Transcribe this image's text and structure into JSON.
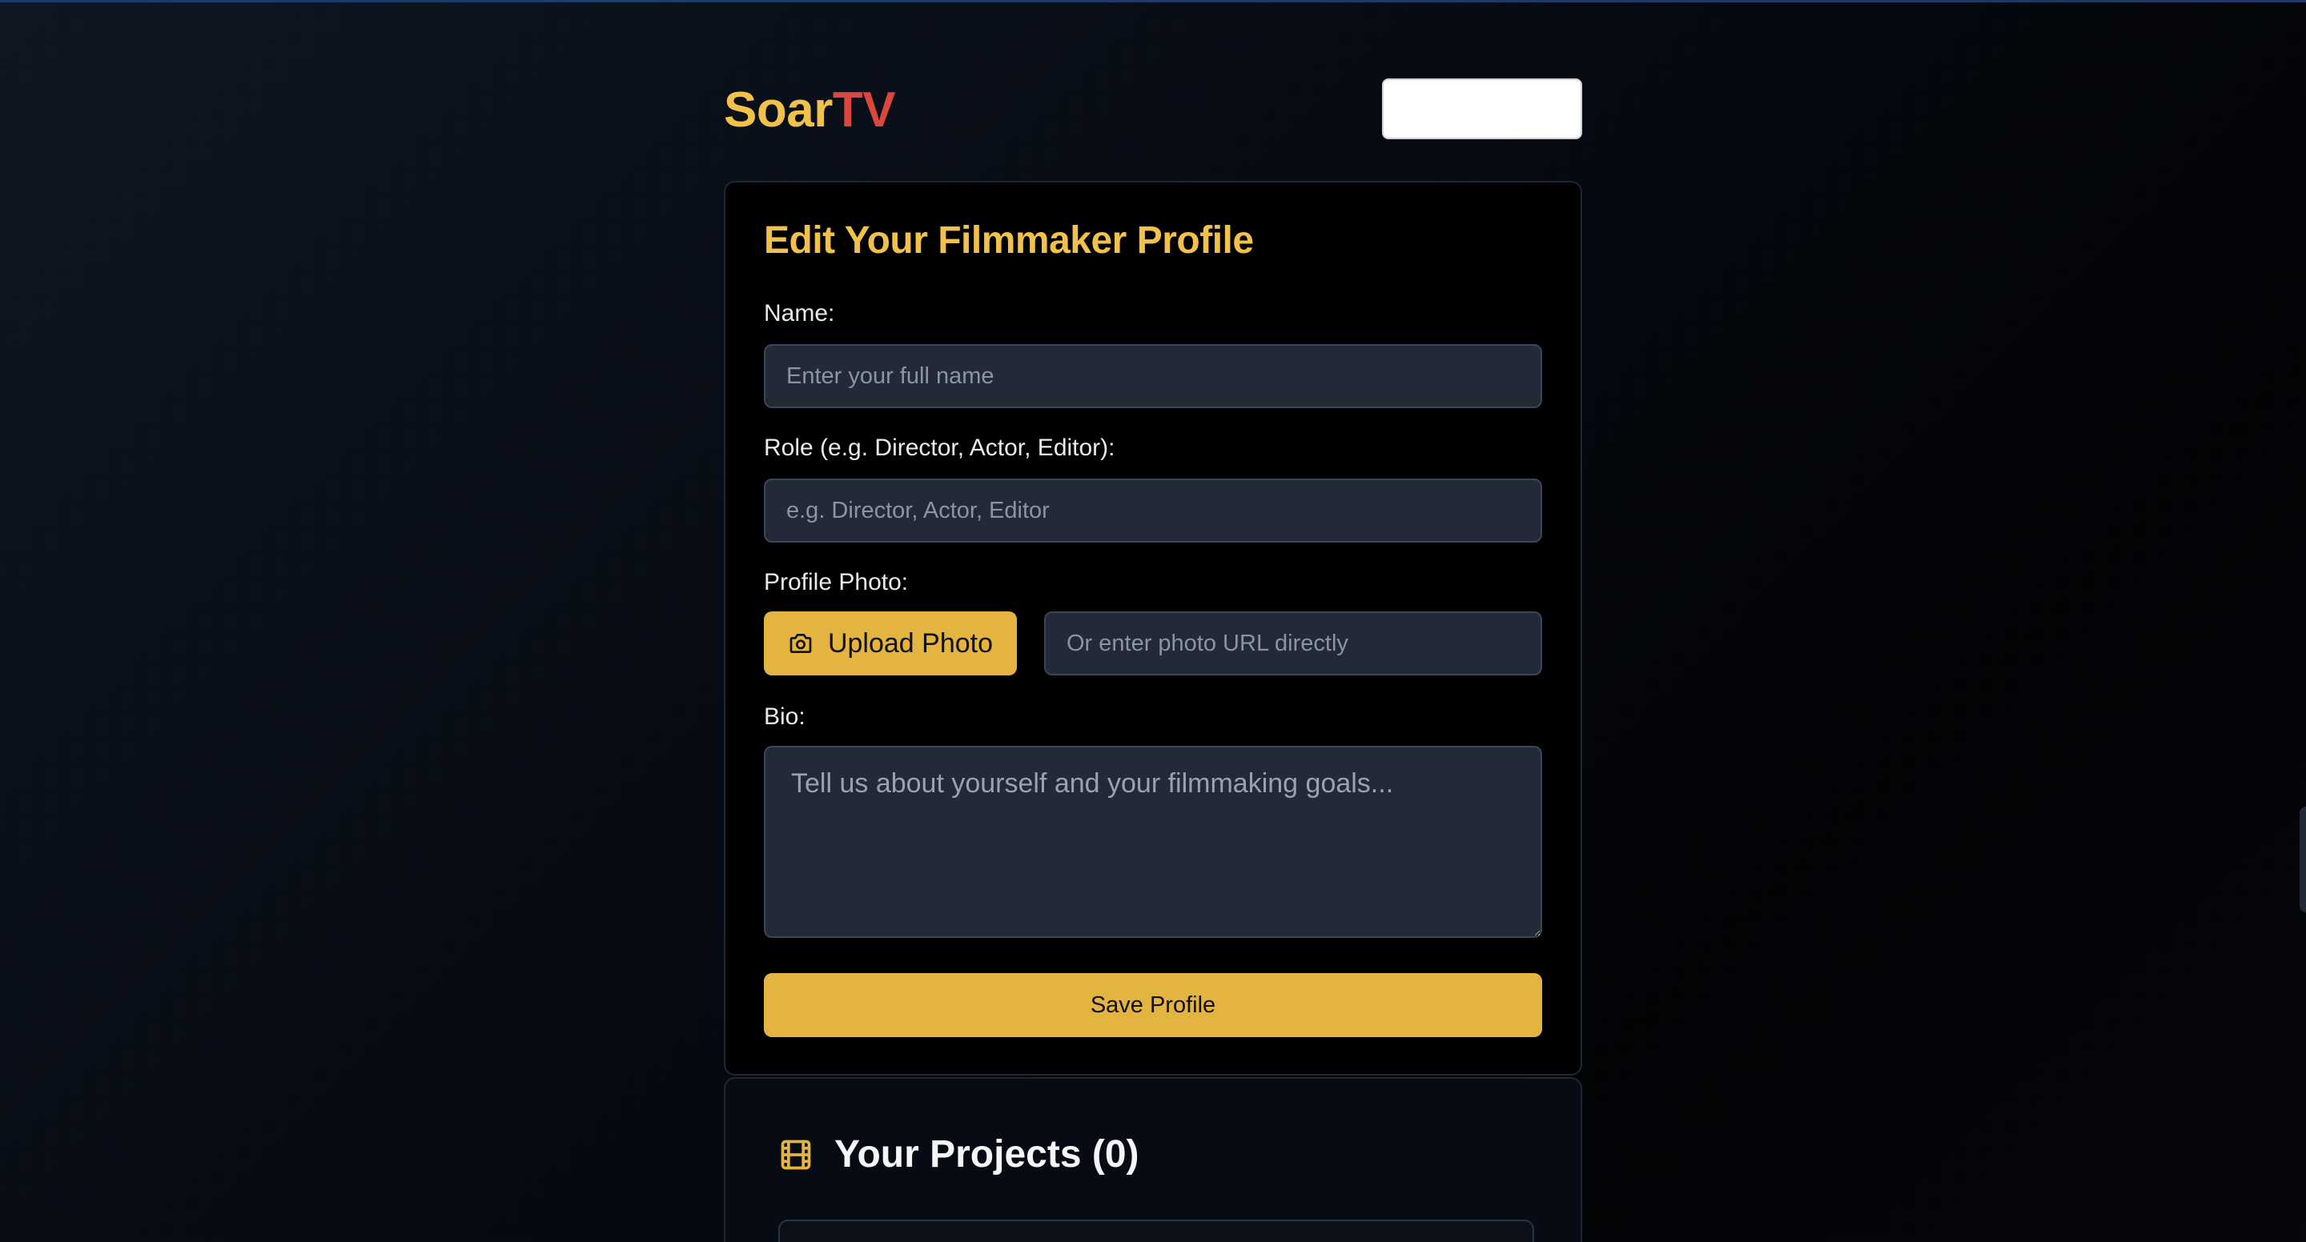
{
  "brand": {
    "part1": "Soar",
    "part2": "TV",
    "colors": {
      "primary": "#f2c14a",
      "accent": "#d9473e"
    }
  },
  "header": {
    "button_label": ""
  },
  "profile_form": {
    "title": "Edit Your Filmmaker Profile",
    "name": {
      "label": "Name:",
      "value": "",
      "placeholder": "Enter your full name"
    },
    "role": {
      "label": "Role (e.g. Director, Actor, Editor):",
      "value": "",
      "placeholder": "e.g. Director, Actor, Editor"
    },
    "photo": {
      "label": "Profile Photo:",
      "upload_button": "Upload Photo",
      "upload_icon": "camera-icon",
      "url_value": "",
      "url_placeholder": "Or enter photo URL directly"
    },
    "bio": {
      "label": "Bio:",
      "value": "",
      "placeholder": "Tell us about yourself and your filmmaking goals..."
    },
    "save_button": "Save Profile"
  },
  "projects": {
    "icon": "film-icon",
    "title": "Your Projects (0)"
  }
}
